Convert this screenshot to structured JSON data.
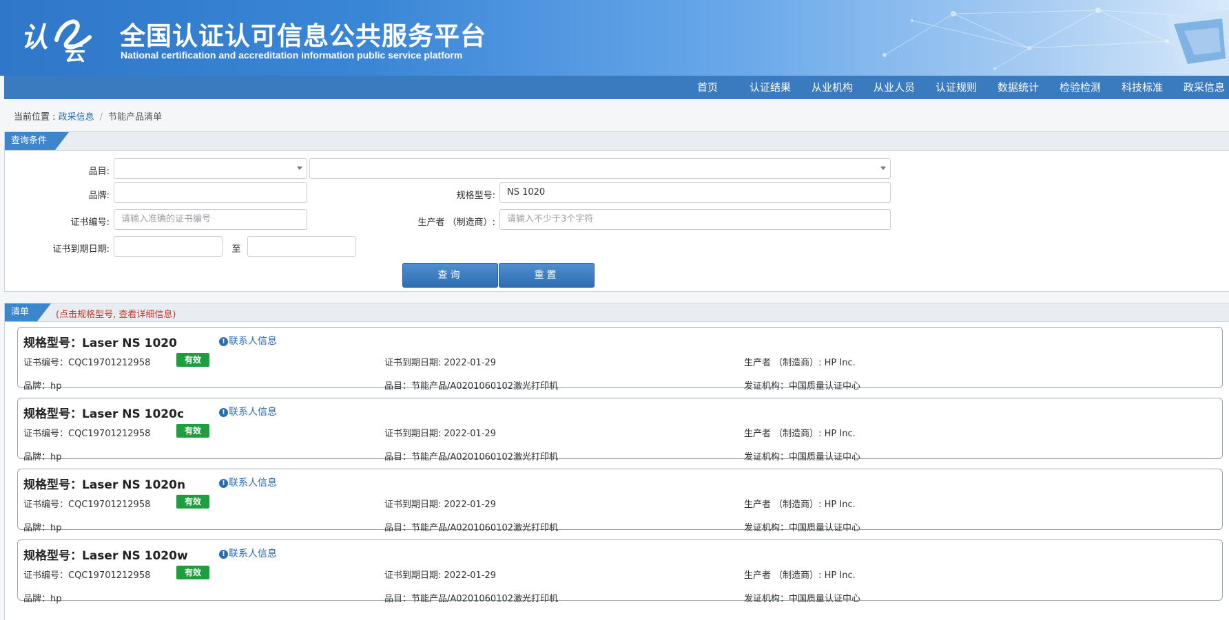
{
  "header": {
    "title": "全国认证认可信息公共服务平台",
    "subtitle": "National certification and accreditation information public service platform",
    "logo_text": "认云"
  },
  "nav": {
    "items": [
      "首页",
      "认证结果",
      "从业机构",
      "从业人员",
      "认证规则",
      "数据统计",
      "检验检测",
      "科技标准",
      "政采信息"
    ]
  },
  "breadcrumb": {
    "prefix": "当前位置 :",
    "link": "政采信息",
    "separator": "/",
    "current": "节能产品清单"
  },
  "query": {
    "tab_label": "查询条件",
    "category_label": "品目:",
    "category_value": "",
    "subcategory_value": "",
    "brand_label": "品牌:",
    "brand_value": "",
    "model_label": "规格型号:",
    "model_value": "NS 1020",
    "cert_no_label": "证书编号:",
    "cert_no_placeholder": "请输入准确的证书编号",
    "maker_label": "生产者 （制造商）:",
    "maker_placeholder": "请输入不少于3个字符",
    "expiry_label": "证书到期日期:",
    "expiry_to": "至",
    "expiry_from_value": "",
    "expiry_to_value": "",
    "search_button": "查询",
    "reset_button": "重置"
  },
  "results": {
    "tab_label": "清单",
    "note": "(点击规格型号, 查看详细信息)",
    "model_prefix": "规格型号：",
    "contact_label": "联系人信息",
    "items": [
      {
        "model": "Laser NS 1020",
        "cert_no": "证书编号：CQC19701212958",
        "status": "有效",
        "expiry": "证书到期日期: 2022-01-29",
        "maker": "生产者 （制造商）: HP Inc.",
        "brand": "品牌：hp",
        "category": "品目：节能产品/A0201060102激光打印机",
        "issuer": "发证机构：中国质量认证中心"
      },
      {
        "model": "Laser NS 1020c",
        "cert_no": "证书编号：CQC19701212958",
        "status": "有效",
        "expiry": "证书到期日期: 2022-01-29",
        "maker": "生产者 （制造商）: HP Inc.",
        "brand": "品牌：hp",
        "category": "品目：节能产品/A0201060102激光打印机",
        "issuer": "发证机构：中国质量认证中心"
      },
      {
        "model": "Laser NS 1020n",
        "cert_no": "证书编号：CQC19701212958",
        "status": "有效",
        "expiry": "证书到期日期: 2022-01-29",
        "maker": "生产者 （制造商）: HP Inc.",
        "brand": "品牌：hp",
        "category": "品目：节能产品/A0201060102激光打印机",
        "issuer": "发证机构：中国质量认证中心"
      },
      {
        "model": "Laser NS 1020w",
        "cert_no": "证书编号：CQC19701212958",
        "status": "有效",
        "expiry": "证书到期日期: 2022-01-29",
        "maker": "生产者 （制造商）: HP Inc.",
        "brand": "品牌：hp",
        "category": "品目：节能产品/A0201060102激光打印机",
        "issuer": "发证机构：中国质量认证中心"
      }
    ]
  },
  "colors": {
    "nav_bg": "#3a7bbf",
    "accent": "#3d86cc",
    "valid_badge": "#1e9e3e",
    "link": "#2a6cb3"
  }
}
